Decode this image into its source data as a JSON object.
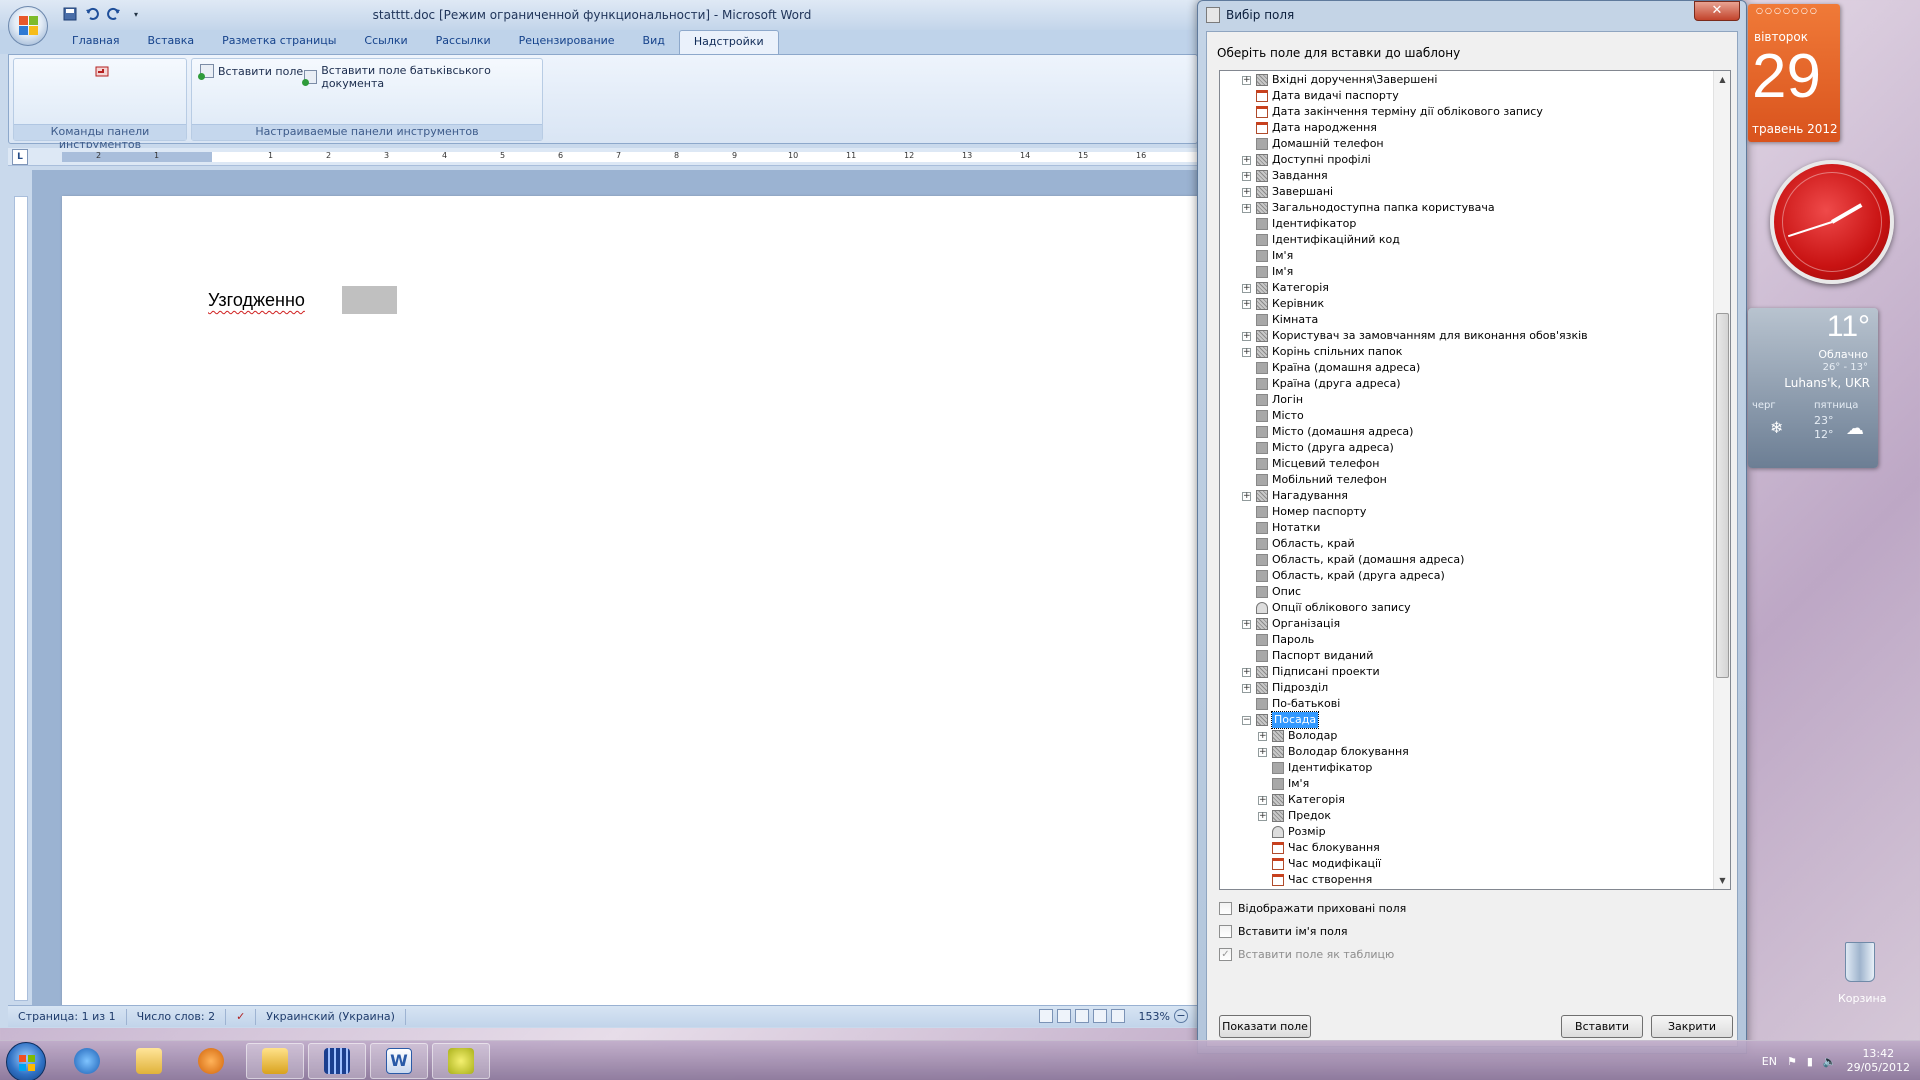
{
  "word": {
    "title": "statttt.doc [Режим ограниченной функциональности] - Microsoft Word",
    "tabs": [
      "Главная",
      "Вставка",
      "Разметка страницы",
      "Ссылки",
      "Рассылки",
      "Рецензирование",
      "Вид",
      "Надстройки"
    ],
    "active_tab": "Надстройки",
    "ribbon": {
      "group1_label": "Команды панели инструментов",
      "group2_label": "Настраиваемые панели инструментов",
      "insert_field": "Вставити поле",
      "insert_parent_field": "Вставити поле батьківського документа"
    },
    "ruler_corner": "L",
    "ruler_numbers": [
      "2",
      "1",
      "1",
      "2",
      "3",
      "4",
      "5",
      "6",
      "7",
      "8",
      "9",
      "10",
      "11",
      "12",
      "13",
      "14",
      "15",
      "16"
    ],
    "document_text": "Узгодженно",
    "status": {
      "page": "Страница: 1 из 1",
      "words": "Число слов: 2",
      "language": "Украинский (Украина)",
      "zoom": "153%"
    }
  },
  "dialog": {
    "title": "Вибір поля",
    "close": "✕",
    "prompt": "Оберіть поле для вставки до шаблону",
    "tree": [
      {
        "label": "Вхідні доручення\\Завершені",
        "icon": "obj",
        "expand": "+",
        "level": 0
      },
      {
        "label": "Дата видачі паспорту",
        "icon": "date",
        "expand": "",
        "level": 0
      },
      {
        "label": "Дата закінчення терміну дії облікового запису",
        "icon": "date",
        "expand": "",
        "level": 0
      },
      {
        "label": "Дата народження",
        "icon": "date",
        "expand": "",
        "level": 0
      },
      {
        "label": "Домашній телефон",
        "icon": "plain",
        "expand": "",
        "level": 0
      },
      {
        "label": "Доступні профілі",
        "icon": "obj",
        "expand": "+",
        "level": 0
      },
      {
        "label": "Завдання",
        "icon": "obj",
        "expand": "+",
        "level": 0
      },
      {
        "label": "Завершані",
        "icon": "obj",
        "expand": "+",
        "level": 0
      },
      {
        "label": "Загальнодоступна папка користувача",
        "icon": "obj",
        "expand": "+",
        "level": 0
      },
      {
        "label": "Ідентифікатор",
        "icon": "plain",
        "expand": "",
        "level": 0
      },
      {
        "label": "Ідентифікаційний код",
        "icon": "plain",
        "expand": "",
        "level": 0
      },
      {
        "label": "Ім'я",
        "icon": "plain",
        "expand": "",
        "level": 0
      },
      {
        "label": "Ім'я",
        "icon": "plain",
        "expand": "",
        "level": 0
      },
      {
        "label": "Категорія",
        "icon": "obj",
        "expand": "+",
        "level": 0
      },
      {
        "label": "Керівник",
        "icon": "obj",
        "expand": "+",
        "level": 0
      },
      {
        "label": "Кімната",
        "icon": "plain",
        "expand": "",
        "level": 0
      },
      {
        "label": "Користувач за замовчанням для виконання обов'язків",
        "icon": "obj",
        "expand": "+",
        "level": 0
      },
      {
        "label": "Корінь спільних папок",
        "icon": "obj",
        "expand": "+",
        "level": 0
      },
      {
        "label": "Країна (домашня адреса)",
        "icon": "plain",
        "expand": "",
        "level": 0
      },
      {
        "label": "Країна (друга адреса)",
        "icon": "plain",
        "expand": "",
        "level": 0
      },
      {
        "label": "Логін",
        "icon": "plain",
        "expand": "",
        "level": 0
      },
      {
        "label": "Місто",
        "icon": "plain",
        "expand": "",
        "level": 0
      },
      {
        "label": "Місто (домашня адреса)",
        "icon": "plain",
        "expand": "",
        "level": 0
      },
      {
        "label": "Місто (друга адреса)",
        "icon": "plain",
        "expand": "",
        "level": 0
      },
      {
        "label": "Місцевий телефон",
        "icon": "plain",
        "expand": "",
        "level": 0
      },
      {
        "label": "Мобільний телефон",
        "icon": "plain",
        "expand": "",
        "level": 0
      },
      {
        "label": "Нагадування",
        "icon": "obj",
        "expand": "+",
        "level": 0
      },
      {
        "label": "Номер паспорту",
        "icon": "plain",
        "expand": "",
        "level": 0
      },
      {
        "label": "Нотатки",
        "icon": "plain",
        "expand": "",
        "level": 0
      },
      {
        "label": "Область, край",
        "icon": "plain",
        "expand": "",
        "level": 0
      },
      {
        "label": "Область, край (домашня адреса)",
        "icon": "plain",
        "expand": "",
        "level": 0
      },
      {
        "label": "Область, край (друга адреса)",
        "icon": "plain",
        "expand": "",
        "level": 0
      },
      {
        "label": "Опис",
        "icon": "plain",
        "expand": "",
        "level": 0
      },
      {
        "label": "Опції облікового запису",
        "icon": "opt",
        "expand": "",
        "level": 0
      },
      {
        "label": "Організація",
        "icon": "obj",
        "expand": "+",
        "level": 0
      },
      {
        "label": "Пароль",
        "icon": "plain",
        "expand": "",
        "level": 0
      },
      {
        "label": "Паспорт виданий",
        "icon": "plain",
        "expand": "",
        "level": 0
      },
      {
        "label": "Підписані проекти",
        "icon": "obj",
        "expand": "+",
        "level": 0
      },
      {
        "label": "Підрозділ",
        "icon": "obj",
        "expand": "+",
        "level": 0
      },
      {
        "label": "По-батькові",
        "icon": "plain",
        "expand": "",
        "level": 0
      },
      {
        "label": "Посада",
        "icon": "obj",
        "expand": "−",
        "level": 0,
        "selected": true
      },
      {
        "label": "Володар",
        "icon": "obj",
        "expand": "+",
        "level": 1
      },
      {
        "label": "Володар блокування",
        "icon": "obj",
        "expand": "+",
        "level": 1
      },
      {
        "label": "Ідентифікатор",
        "icon": "plain",
        "expand": "",
        "level": 1
      },
      {
        "label": "Ім'я",
        "icon": "plain",
        "expand": "",
        "level": 1
      },
      {
        "label": "Категорія",
        "icon": "obj",
        "expand": "+",
        "level": 1
      },
      {
        "label": "Предок",
        "icon": "obj",
        "expand": "+",
        "level": 1
      },
      {
        "label": "Розмір",
        "icon": "opt",
        "expand": "",
        "level": 1
      },
      {
        "label": "Час блокування",
        "icon": "date",
        "expand": "",
        "level": 1
      },
      {
        "label": "Час модифікації",
        "icon": "date",
        "expand": "",
        "level": 1
      },
      {
        "label": "Час створення",
        "icon": "date",
        "expand": "",
        "level": 1
      }
    ],
    "checkboxes": {
      "show_hidden": "Відображати приховані поля",
      "insert_name": "Вставити ім'я поля",
      "insert_as_table": "Вставити поле як таблицю"
    },
    "buttons": {
      "show_field": "Показати поле",
      "insert": "Вставити",
      "close": "Закрити"
    }
  },
  "gadgets": {
    "calendar_dow": "вівторок",
    "calendar_day": "29",
    "calendar_month": "травень 2012",
    "weather_temp": "11°",
    "weather_cond": "Облачно",
    "weather_range": "26° - 13°",
    "weather_city": "Luhans'k, UKR",
    "fc1_day": "черг",
    "fc2_day": "пятница",
    "fc2_hi": "23°",
    "fc2_lo": "12°",
    "recycle_label": "Корзина"
  },
  "taskbar": {
    "lang": "EN",
    "time": "13:42",
    "date": "29/05/2012"
  }
}
